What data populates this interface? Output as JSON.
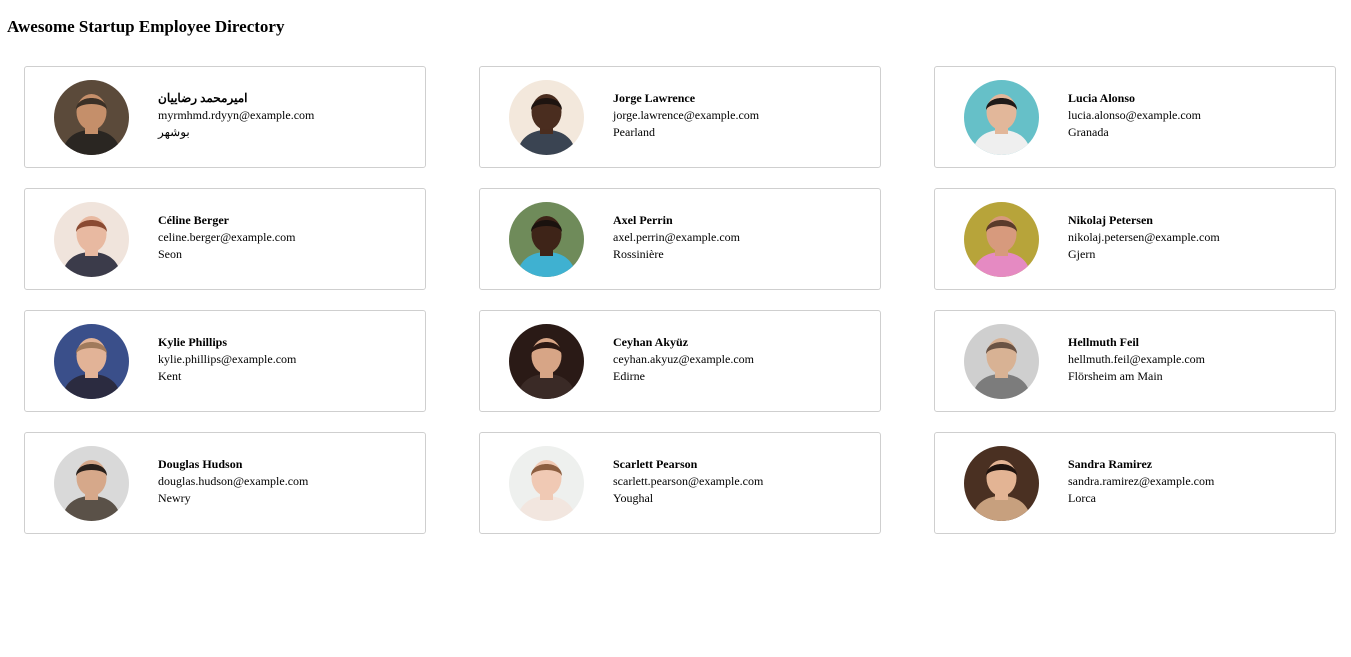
{
  "page": {
    "title": "Awesome Startup Employee Directory"
  },
  "employees": [
    {
      "name": "اميرمحمد رضاييان",
      "email": "myrmhmd.rdyyn@example.com",
      "city": "بوشهر",
      "avatar": {
        "bg": "#5b4a3a",
        "skin": "#c58f6a",
        "hair": "#3b3026",
        "shirt": "#2a2622",
        "icon": "person-photo"
      }
    },
    {
      "name": "Jorge Lawrence",
      "email": "jorge.lawrence@example.com",
      "city": "Pearland",
      "avatar": {
        "bg": "#f3e8dc",
        "skin": "#4a2d1f",
        "hair": "#1e1410",
        "shirt": "#3a4452",
        "icon": "person-photo"
      }
    },
    {
      "name": "Lucia Alonso",
      "email": "lucia.alonso@example.com",
      "city": "Granada",
      "avatar": {
        "bg": "#66c0c8",
        "skin": "#e2b79a",
        "hair": "#1f1a18",
        "shirt": "#efefef",
        "icon": "person-photo"
      }
    },
    {
      "name": "Céline Berger",
      "email": "celine.berger@example.com",
      "city": "Seon",
      "avatar": {
        "bg": "#f0e4dc",
        "skin": "#e8b9a1",
        "hair": "#8a4a32",
        "shirt": "#3b3b4a",
        "icon": "person-photo"
      }
    },
    {
      "name": "Axel Perrin",
      "email": "axel.perrin@example.com",
      "city": "Rossinière",
      "avatar": {
        "bg": "#6f8b5a",
        "skin": "#3e2418",
        "hair": "#1a120e",
        "shirt": "#3fb1d1",
        "icon": "person-photo"
      }
    },
    {
      "name": "Nikolaj Petersen",
      "email": "nikolaj.petersen@example.com",
      "city": "Gjern",
      "avatar": {
        "bg": "#b7a43a",
        "skin": "#d79a7d",
        "hair": "#5a3b2b",
        "shirt": "#e58ac2",
        "icon": "person-photo"
      }
    },
    {
      "name": "Kylie Phillips",
      "email": "kylie.phillips@example.com",
      "city": "Kent",
      "avatar": {
        "bg": "#3a4f8a",
        "skin": "#e2b397",
        "hair": "#a07a5c",
        "shirt": "#2b2b40",
        "icon": "person-photo"
      }
    },
    {
      "name": "Ceyhan Akyüz",
      "email": "ceyhan.akyuz@example.com",
      "city": "Edirne",
      "avatar": {
        "bg": "#2a1a16",
        "skin": "#d7a586",
        "hair": "#2b1813",
        "shirt": "#3a2a26",
        "icon": "person-photo"
      }
    },
    {
      "name": "Hellmuth Feil",
      "email": "hellmuth.feil@example.com",
      "city": "Flörsheim am Main",
      "avatar": {
        "bg": "#cfcfcf",
        "skin": "#d8b294",
        "hair": "#6a5344",
        "shirt": "#7c7c7c",
        "icon": "person-photo"
      }
    },
    {
      "name": "Douglas Hudson",
      "email": "douglas.hudson@example.com",
      "city": "Newry",
      "avatar": {
        "bg": "#d9d9d9",
        "skin": "#d6a88a",
        "hair": "#2a211c",
        "shirt": "#5a5148",
        "icon": "person-photo"
      }
    },
    {
      "name": "Scarlett Pearson",
      "email": "scarlett.pearson@example.com",
      "city": "Youghal",
      "avatar": {
        "bg": "#eef0ee",
        "skin": "#f0c9b4",
        "hair": "#8c5e40",
        "shirt": "#f2e6df",
        "icon": "person-photo"
      }
    },
    {
      "name": "Sandra Ramirez",
      "email": "sandra.ramirez@example.com",
      "city": "Lorca",
      "avatar": {
        "bg": "#4a3022",
        "skin": "#e3b494",
        "hair": "#20140f",
        "shirt": "#c7a07e",
        "icon": "person-photo"
      }
    }
  ]
}
